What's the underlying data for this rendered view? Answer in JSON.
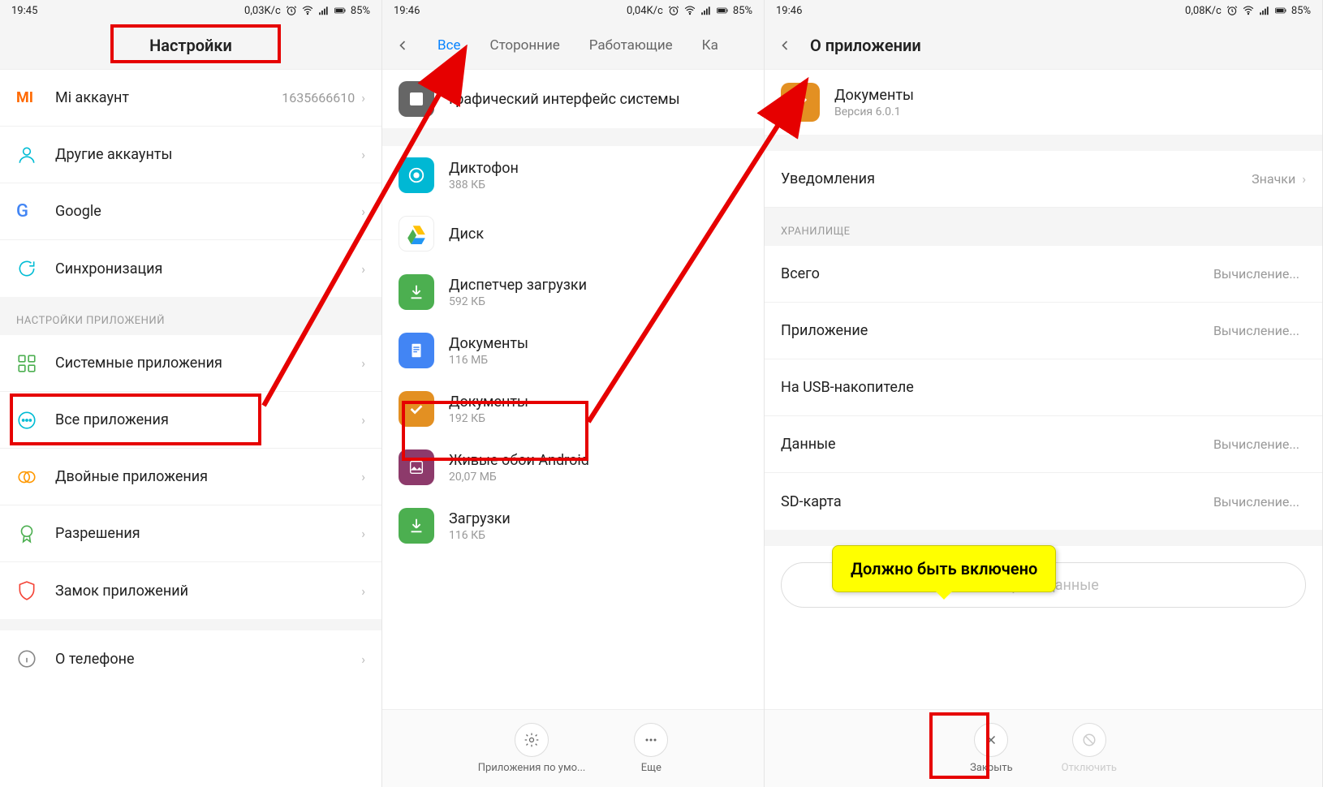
{
  "panel1": {
    "status": {
      "time": "19:45",
      "speed": "0,03K/c",
      "battery": "85%"
    },
    "title": "Настройки",
    "rows": [
      {
        "label": "Mi аккаунт",
        "value": "1635666610"
      },
      {
        "label": "Другие аккаунты"
      },
      {
        "label": "Google"
      },
      {
        "label": "Синхронизация"
      }
    ],
    "section": "НАСТРОЙКИ ПРИЛОЖЕНИЙ",
    "rows2": [
      {
        "label": "Системные приложения"
      },
      {
        "label": "Все приложения"
      },
      {
        "label": "Двойные приложения"
      },
      {
        "label": "Разрешения"
      },
      {
        "label": "Замок приложений"
      },
      {
        "label": "О телефоне"
      }
    ]
  },
  "panel2": {
    "status": {
      "time": "19:46",
      "speed": "0,04K/c",
      "battery": "85%"
    },
    "tabs": [
      "Все",
      "Сторонние",
      "Работающие",
      "Ка"
    ],
    "apps": [
      {
        "name": "Графический интерфейс системы",
        "size": "",
        "bg": "#666"
      },
      {
        "name": "Диктофон",
        "size": "388 КБ",
        "bg": "#00b8d4"
      },
      {
        "name": "Диск",
        "size": "",
        "bg": "#fff"
      },
      {
        "name": "Диспетчер загрузки",
        "size": "592 КБ",
        "bg": "#4caf50"
      },
      {
        "name": "Документы",
        "size": "116 МБ",
        "bg": "#4285f4"
      },
      {
        "name": "Документы",
        "size": "192 КБ",
        "bg": "#e39022"
      },
      {
        "name": "Живые обои Android",
        "size": "20,07 МБ",
        "bg": "#8d3a6b"
      },
      {
        "name": "Загрузки",
        "size": "116 КБ",
        "bg": "#4caf50"
      }
    ],
    "bottom": {
      "defaults": "Приложения по умо...",
      "more": "Еще"
    }
  },
  "panel3": {
    "status": {
      "time": "19:46",
      "speed": "0,08K/c",
      "battery": "85%"
    },
    "title": "О приложении",
    "app": {
      "name": "Документы",
      "version": "Версия 6.0.1"
    },
    "notif": {
      "label": "Уведомления",
      "value": "Значки"
    },
    "storage_header": "ХРАНИЛИЩЕ",
    "storage": [
      {
        "label": "Всего",
        "value": "Вычисление..."
      },
      {
        "label": "Приложение",
        "value": "Вычисление..."
      },
      {
        "label": "На USB-накопителе",
        "value": ""
      },
      {
        "label": "Данные",
        "value": "Вычисление..."
      },
      {
        "label": "SD-карта",
        "value": "Вычисление..."
      }
    ],
    "clear": "Стереть данные",
    "bottom": {
      "close": "Закрыть",
      "disable": "Отключить"
    }
  },
  "tooltip": "Должно быть включено"
}
